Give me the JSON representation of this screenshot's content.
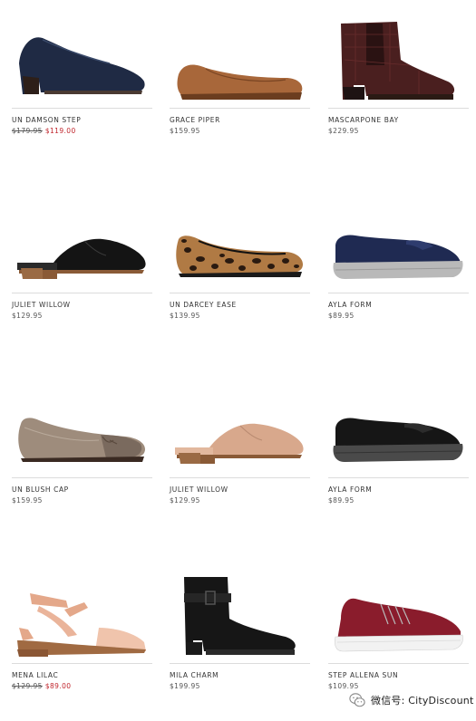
{
  "products": [
    {
      "name": "UN DAMSON STEP",
      "price": "",
      "old_price": "$179.95",
      "sale_price": "$119.00",
      "icon": "navy-heel-pump-icon"
    },
    {
      "name": "GRACE PIPER",
      "price": "$159.95",
      "old_price": "",
      "sale_price": "",
      "icon": "tan-ballet-flat-icon"
    },
    {
      "name": "MASCARPONE BAY",
      "price": "$229.95",
      "old_price": "",
      "sale_price": "",
      "icon": "burgundy-croc-ankle-boot-icon"
    },
    {
      "name": "JULIET WILLOW",
      "price": "$129.95",
      "old_price": "",
      "sale_price": "",
      "icon": "black-mule-icon"
    },
    {
      "name": "UN DARCEY EASE",
      "price": "$139.95",
      "old_price": "",
      "sale_price": "",
      "icon": "leopard-flat-icon"
    },
    {
      "name": "AYLA FORM",
      "price": "$89.95",
      "old_price": "",
      "sale_price": "",
      "icon": "navy-loafer-icon"
    },
    {
      "name": "UN BLUSH CAP",
      "price": "$159.95",
      "old_price": "",
      "sale_price": "",
      "icon": "metallic-cap-toe-flat-icon"
    },
    {
      "name": "JULIET WILLOW",
      "price": "$129.95",
      "old_price": "",
      "sale_price": "",
      "icon": "blush-mule-icon"
    },
    {
      "name": "AYLA FORM",
      "price": "$89.95",
      "old_price": "",
      "sale_price": "",
      "icon": "black-loafer-icon"
    },
    {
      "name": "MENA LILAC",
      "price": "",
      "old_price": "$129.95",
      "sale_price": "$89.00",
      "icon": "peach-wedge-sandal-icon"
    },
    {
      "name": "MILA CHARM",
      "price": "$199.95",
      "old_price": "",
      "sale_price": "",
      "icon": "black-ankle-boot-icon"
    },
    {
      "name": "STEP ALLENA SUN",
      "price": "$109.95",
      "old_price": "",
      "sale_price": "",
      "icon": "red-knit-sneaker-icon"
    }
  ],
  "watermark": {
    "text": "微信号: CityDiscount",
    "icon": "wechat-icon"
  },
  "colors": {
    "sale_red": "#c0262d",
    "text": "#333333",
    "divider": "#dcdcdc"
  }
}
